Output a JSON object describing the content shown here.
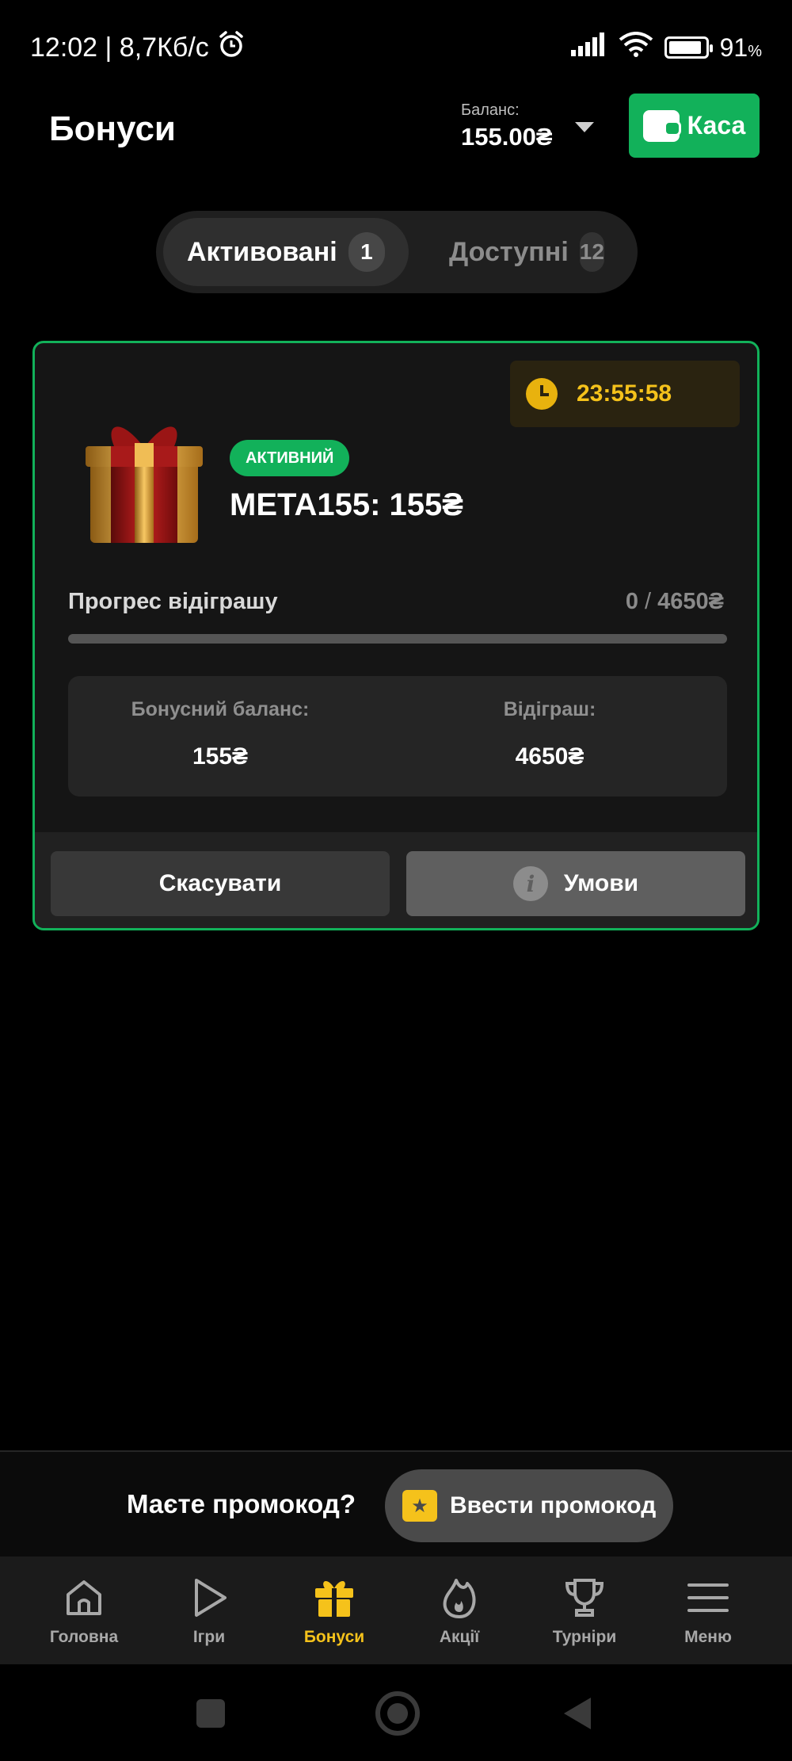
{
  "status_bar": {
    "time_net": "12:02 | 8,7Кб/с",
    "battery": "91",
    "battery_unit": "%",
    "battery_level": 0.91
  },
  "header": {
    "title": "Бонуси",
    "balance_label": "Баланс:",
    "balance_value": "155.00₴",
    "cashier_label": "Каса"
  },
  "tabs": [
    {
      "label": "Активовані",
      "count": "1"
    },
    {
      "label": "Доступні",
      "count": "12"
    }
  ],
  "bonus": {
    "timer": "23:55:58",
    "status": "АКТИВНИЙ",
    "name": "META155: 155₴",
    "progress_label": "Прогрес відіграшу",
    "progress_current": "0",
    "progress_target": "4650₴",
    "progress_fraction": 0,
    "bonus_balance_label": "Бонусний баланс:",
    "bonus_balance_value": "155₴",
    "wager_label": "Відіграш:",
    "wager_value": "4650₴",
    "cancel_label": "Скасувати",
    "terms_label": "Умови"
  },
  "promo": {
    "question": "Маєте промокод?",
    "button_label": "Ввести промокод"
  },
  "nav": [
    {
      "label": "Головна",
      "icon": "home-icon"
    },
    {
      "label": "Ігри",
      "icon": "play-icon"
    },
    {
      "label": "Бонуси",
      "icon": "gift-icon"
    },
    {
      "label": "Акції",
      "icon": "flame-icon"
    },
    {
      "label": "Турніри",
      "icon": "trophy-icon"
    },
    {
      "label": "Меню",
      "icon": "menu-icon"
    }
  ],
  "colors": {
    "accent_green": "#12b15a",
    "accent_yellow": "#f5c21b",
    "background": "#000000",
    "card": "#151515"
  }
}
